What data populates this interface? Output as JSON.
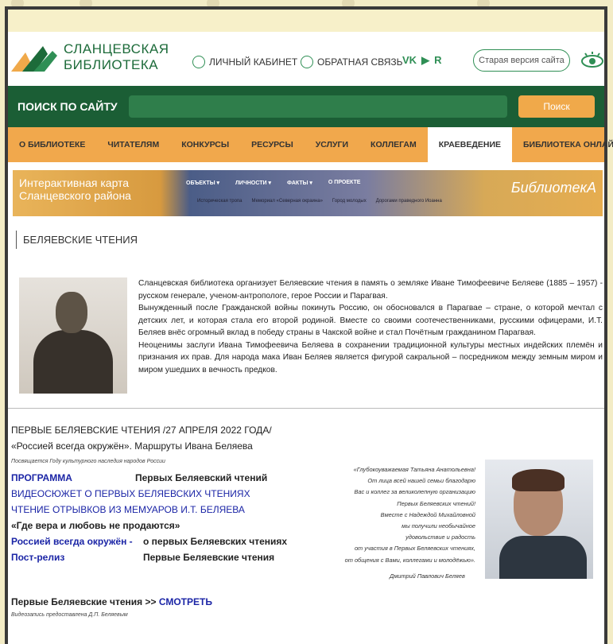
{
  "header": {
    "logo_line1": "СЛАНЦЕВСКАЯ",
    "logo_line2": "БИБЛИОТЕКА",
    "cabinet": "ЛИЧНЫЙ КАБИНЕТ",
    "feedback": "ОБРАТНАЯ СВЯЗЬ",
    "social": [
      "VK",
      "▶",
      "R"
    ],
    "old_site": "Старая версия сайта"
  },
  "search": {
    "label": "ПОИСК ПО САЙТУ",
    "value": "",
    "button": "Поиск"
  },
  "nav": [
    "О БИБЛИОТЕКЕ",
    "ЧИТАТЕЛЯМ",
    "КОНКУРСЫ",
    "РЕСУРСЫ",
    "УСЛУГИ",
    "КОЛЛЕГАМ",
    "КРАЕВЕДЕНИЕ",
    "БИБЛИОТЕКА ОНЛАЙН"
  ],
  "banner": {
    "title_line1": "Интерактивная карта",
    "title_line2": "Сланцевского района",
    "menu": [
      "ОБЪЕКТЫ ▾",
      "ЛИЧНОСТИ ▾",
      "ФАКТЫ ▾",
      "О ПРОЕКТЕ"
    ],
    "links": [
      "Историческая тропа",
      "Мемориал «Северная окраина»",
      "Город молодых",
      "Дорогами праведного Иоанна"
    ],
    "brand": "БиблиотекА"
  },
  "section_title": "БЕЛЯЕВСКИЕ ЧТЕНИЯ",
  "intro": {
    "p1": "Сланцевская библиотека организует Беляевские чтения в память о земляке Иване Тимофеевиче Беляеве (1885 – 1957) - русском генерале, ученом-антропологе, герое России и Парагвая.",
    "p2": "Вынужденный после Гражданской войны покинуть Россию, он обосновался в Парагвае – стране, о которой мечтал с детских лет, и которая стала его второй родиной. Вместе со своими соотечественниками, русскими офицерами, И.Т. Беляев внёс огромный вклад в победу страны в Чакской войне и стал Почётным гражданином Парагвая.",
    "p3": "Неоценимы заслуги Ивана Тимофеевича Беляева в сохранении традиционной культуры местных индейских племён и признания их прав. Для народа мака Иван Беляев является фигурой сакральной – посредником между земным миром и миром ушедших в вечность предков."
  },
  "lower": {
    "title1": "ПЕРВЫЕ БЕЛЯЕВСКИЕ ЧТЕНИЯ  /27 АПРЕЛЯ 2022 ГОДА/",
    "title2": "«Россией всегда окружён». Маршруты Ивана Беляева",
    "dedication": "Посвящается Году культурного наследия народов России",
    "program_link": "ПРОГРАММА",
    "program_desc": "Первых Беляевский чтений",
    "video_link": "ВИДЕОСЮЖЕТ О ПЕРВЫХ БЕЛЯЕВСКИХ ЧТЕНИЯХ",
    "memoir_link": "ЧТЕНИЕ  ОТРЫВКОВ ИЗ МЕМУАРОВ И.Т. БЕЛЯЕВА",
    "faith": "«Где вера и любовь не продаются»",
    "russia_link": "Россией всегда окружён -",
    "russia_desc": "о первых Беляевских чтениях",
    "release_link": "Пост-релиз",
    "release_desc": "Первые Беляевские чтения",
    "quote": [
      "«Глубокоуважаемая Татьяна Анатольевна!",
      "От лица всей нашей семьи благодарю",
      "Вас и коллег за великолепную организацию",
      "Первых Беляевских чтений!",
      "Вместе с Надеждой Михайловной",
      "мы получили необычайное",
      "удовольствие и радость",
      "от участия в Первых Беляевских чтениях,",
      "от общения с Вами, коллегами и молодёжью»."
    ],
    "quote_author": "Дмитрий Павлович Беляев",
    "bottom_text": "Первые Беляевские чтения >> ",
    "bottom_link": "СМОТРЕТЬ",
    "bottom_note": "Видеозапись предоставлена Д.П. Беляевым"
  },
  "colors": {
    "green_dark": "#1b5e35",
    "orange": "#f1a84c",
    "link_blue": "#1b25a6"
  }
}
